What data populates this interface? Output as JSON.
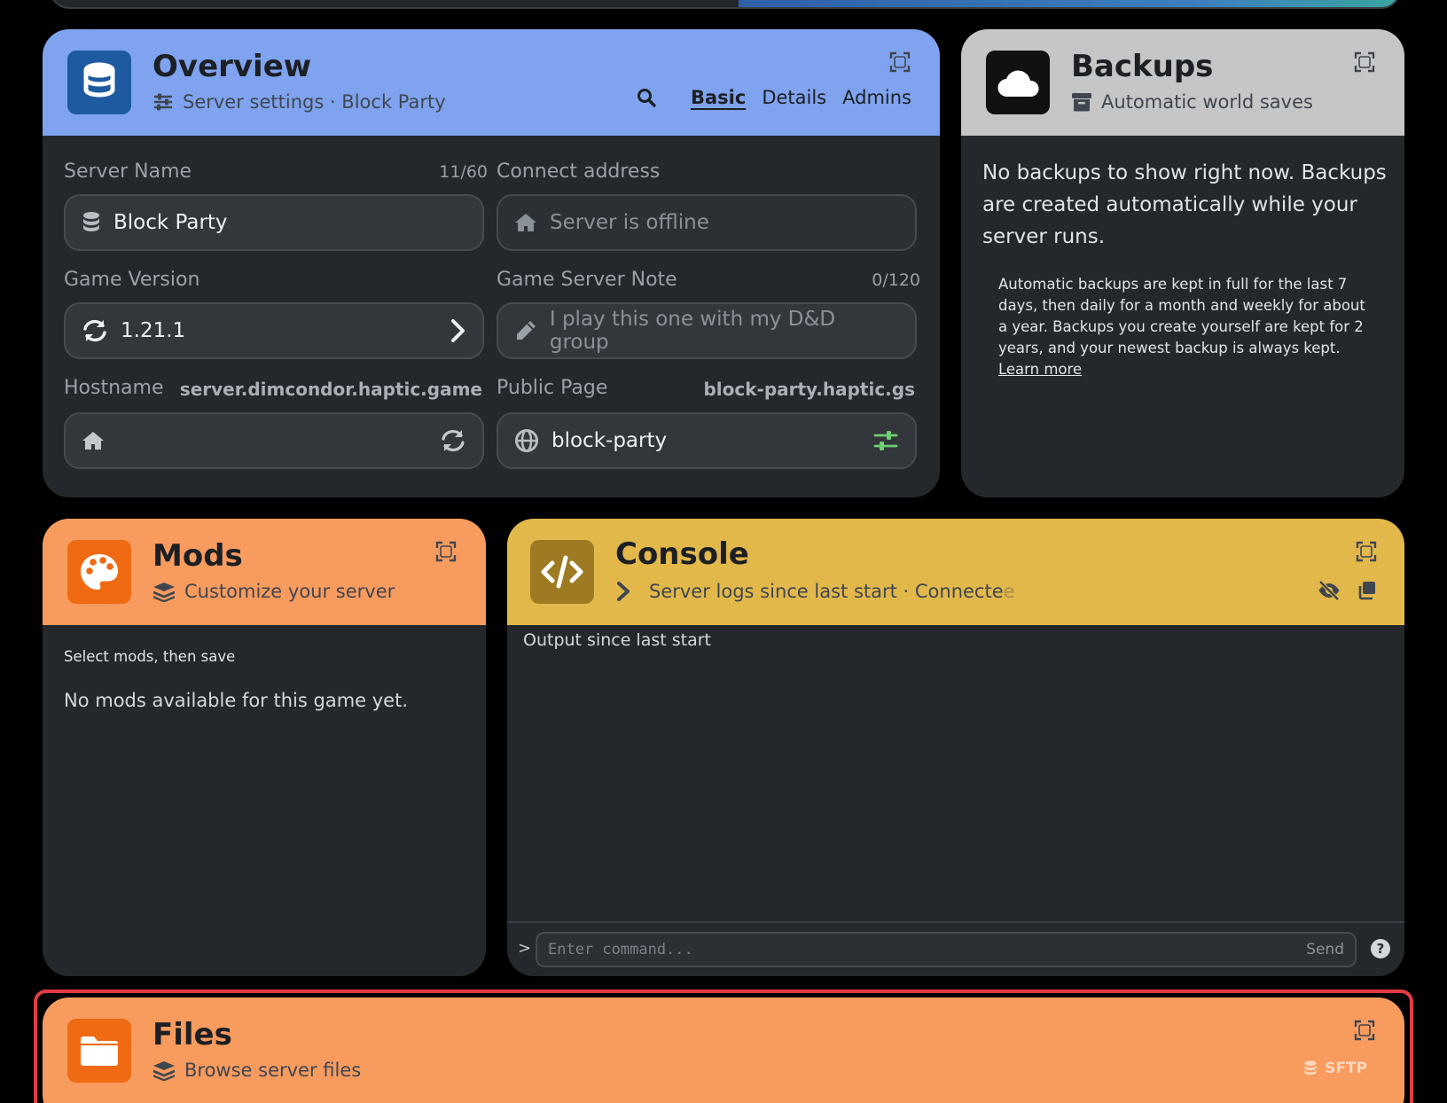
{
  "colors": {
    "overview_header": "#7fa3ee",
    "backups_header": "#c6c6c6",
    "mods_header": "#f89b5e",
    "console_header": "#e2b84b",
    "files_header": "#f89b5e",
    "card_body": "#24272b",
    "highlight_border": "#e23b44"
  },
  "overview": {
    "title": "Overview",
    "subtitle": "Server settings · Block Party",
    "tabs": [
      "Basic",
      "Details",
      "Admins"
    ],
    "active_tab": "Basic",
    "server_name": {
      "label": "Server Name",
      "counter": "11/60",
      "value": "Block Party"
    },
    "connect_address": {
      "label": "Connect address",
      "placeholder": "Server is offline"
    },
    "game_version": {
      "label": "Game Version",
      "value": "1.21.1"
    },
    "server_note": {
      "label": "Game Server Note",
      "counter": "0/120",
      "placeholder": "I play this one with my D&D group"
    },
    "hostname": {
      "label": "Hostname",
      "domain": "server.dimcondor.haptic.game",
      "value": ""
    },
    "public_page": {
      "label": "Public Page",
      "domain": "block-party.haptic.gs",
      "value": "block-party"
    }
  },
  "backups": {
    "title": "Backups",
    "subtitle": "Automatic world saves",
    "empty_message": "No backups to show right now. Backups are created automatically while your server runs.",
    "policy": "Automatic backups are kept in full for the last 7 days, then daily for a month and weekly for about a year. Backups you create yourself are kept for 2 years, and your newest backup is always kept.",
    "learn_more": "Learn more"
  },
  "mods": {
    "title": "Mods",
    "subtitle": "Customize your server",
    "instruction": "Select mods, then save",
    "empty_message": "No mods available for this game yet."
  },
  "console": {
    "title": "Console",
    "subtitle": "Server logs since last start · Connecte",
    "fade_char": "e",
    "output_label": "Output since last start",
    "prompt": ">",
    "input_placeholder": "Enter command...",
    "send_label": "Send"
  },
  "files": {
    "title": "Files",
    "subtitle": "Browse server files",
    "sftp_label": "SFTP"
  }
}
